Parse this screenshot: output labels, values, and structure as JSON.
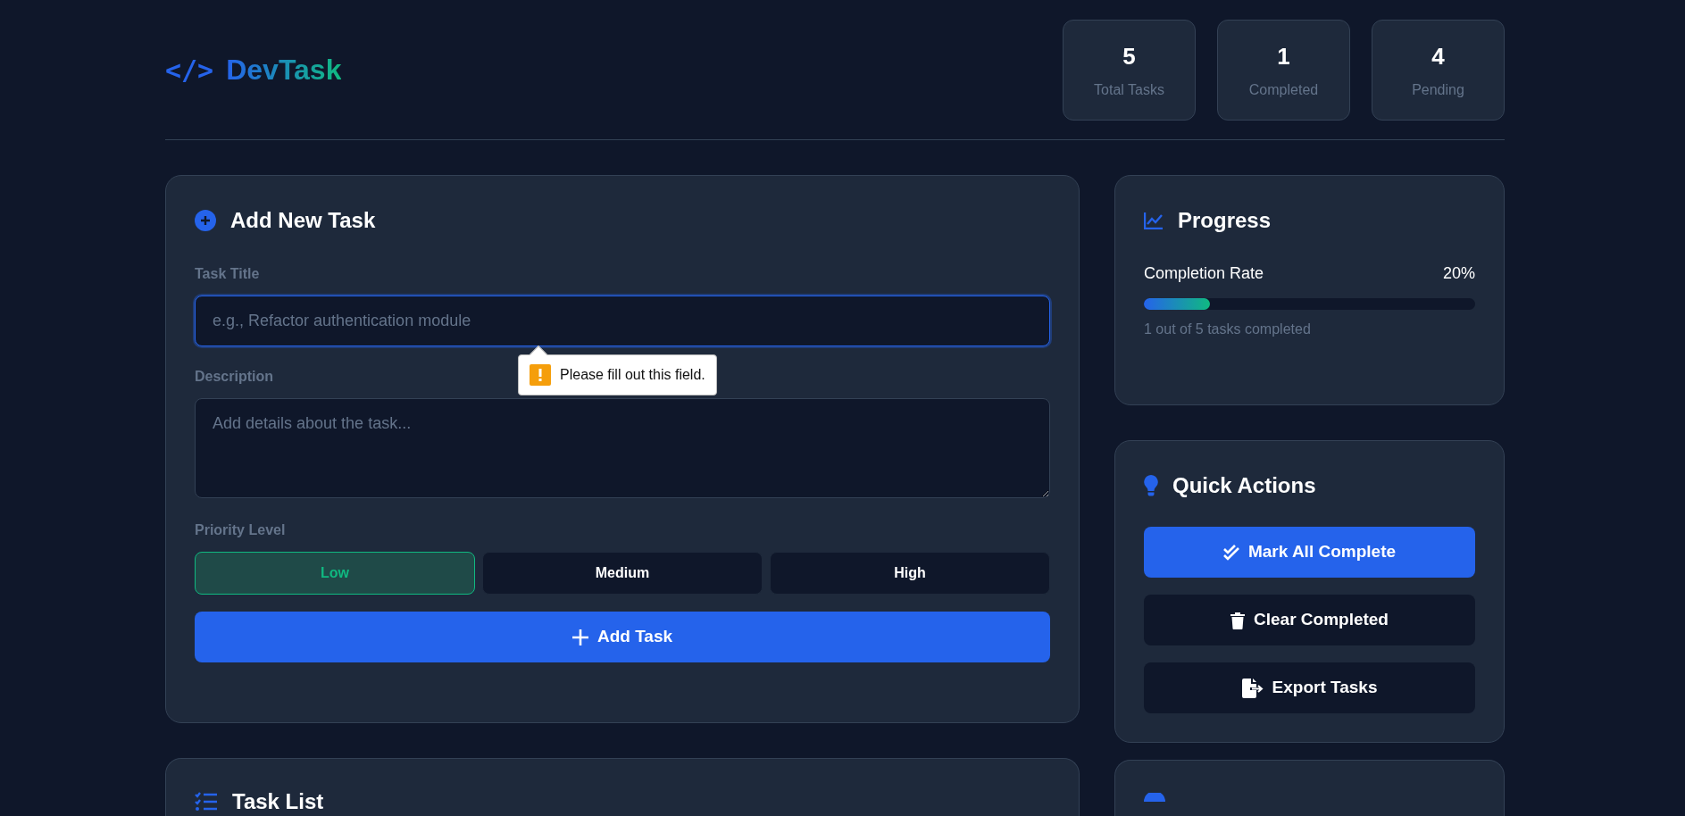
{
  "header": {
    "logo_icon": "</>",
    "title": "DevTask"
  },
  "stats": [
    {
      "value": "5",
      "label": "Total Tasks"
    },
    {
      "value": "1",
      "label": "Completed"
    },
    {
      "value": "4",
      "label": "Pending"
    }
  ],
  "add_task": {
    "title": "Add New Task",
    "title_label": "Task Title",
    "title_placeholder": "e.g., Refactor authentication module",
    "focused": true,
    "validation_tooltip": "Please fill out this field.",
    "description_label": "Description",
    "description_placeholder": "Add details about the task...",
    "priority_label": "Priority Level",
    "priorities": [
      {
        "label": "Low",
        "selected": true
      },
      {
        "label": "Medium",
        "selected": false
      },
      {
        "label": "High",
        "selected": false
      }
    ],
    "submit": "Add Task"
  },
  "task_list": {
    "title": "Task List"
  },
  "progress": {
    "title": "Progress",
    "label": "Completion Rate",
    "reading": "20%",
    "level": 0.2,
    "summary": "1 out of 5 tasks completed"
  },
  "quick_actions": {
    "title": "Quick Actions",
    "buttons": [
      {
        "label": "Mark All Complete",
        "kind": "check",
        "primary": true
      },
      {
        "label": "Clear Completed",
        "kind": "trash",
        "primary": false
      },
      {
        "label": "Export Tasks",
        "kind": "export",
        "primary": false
      }
    ]
  }
}
